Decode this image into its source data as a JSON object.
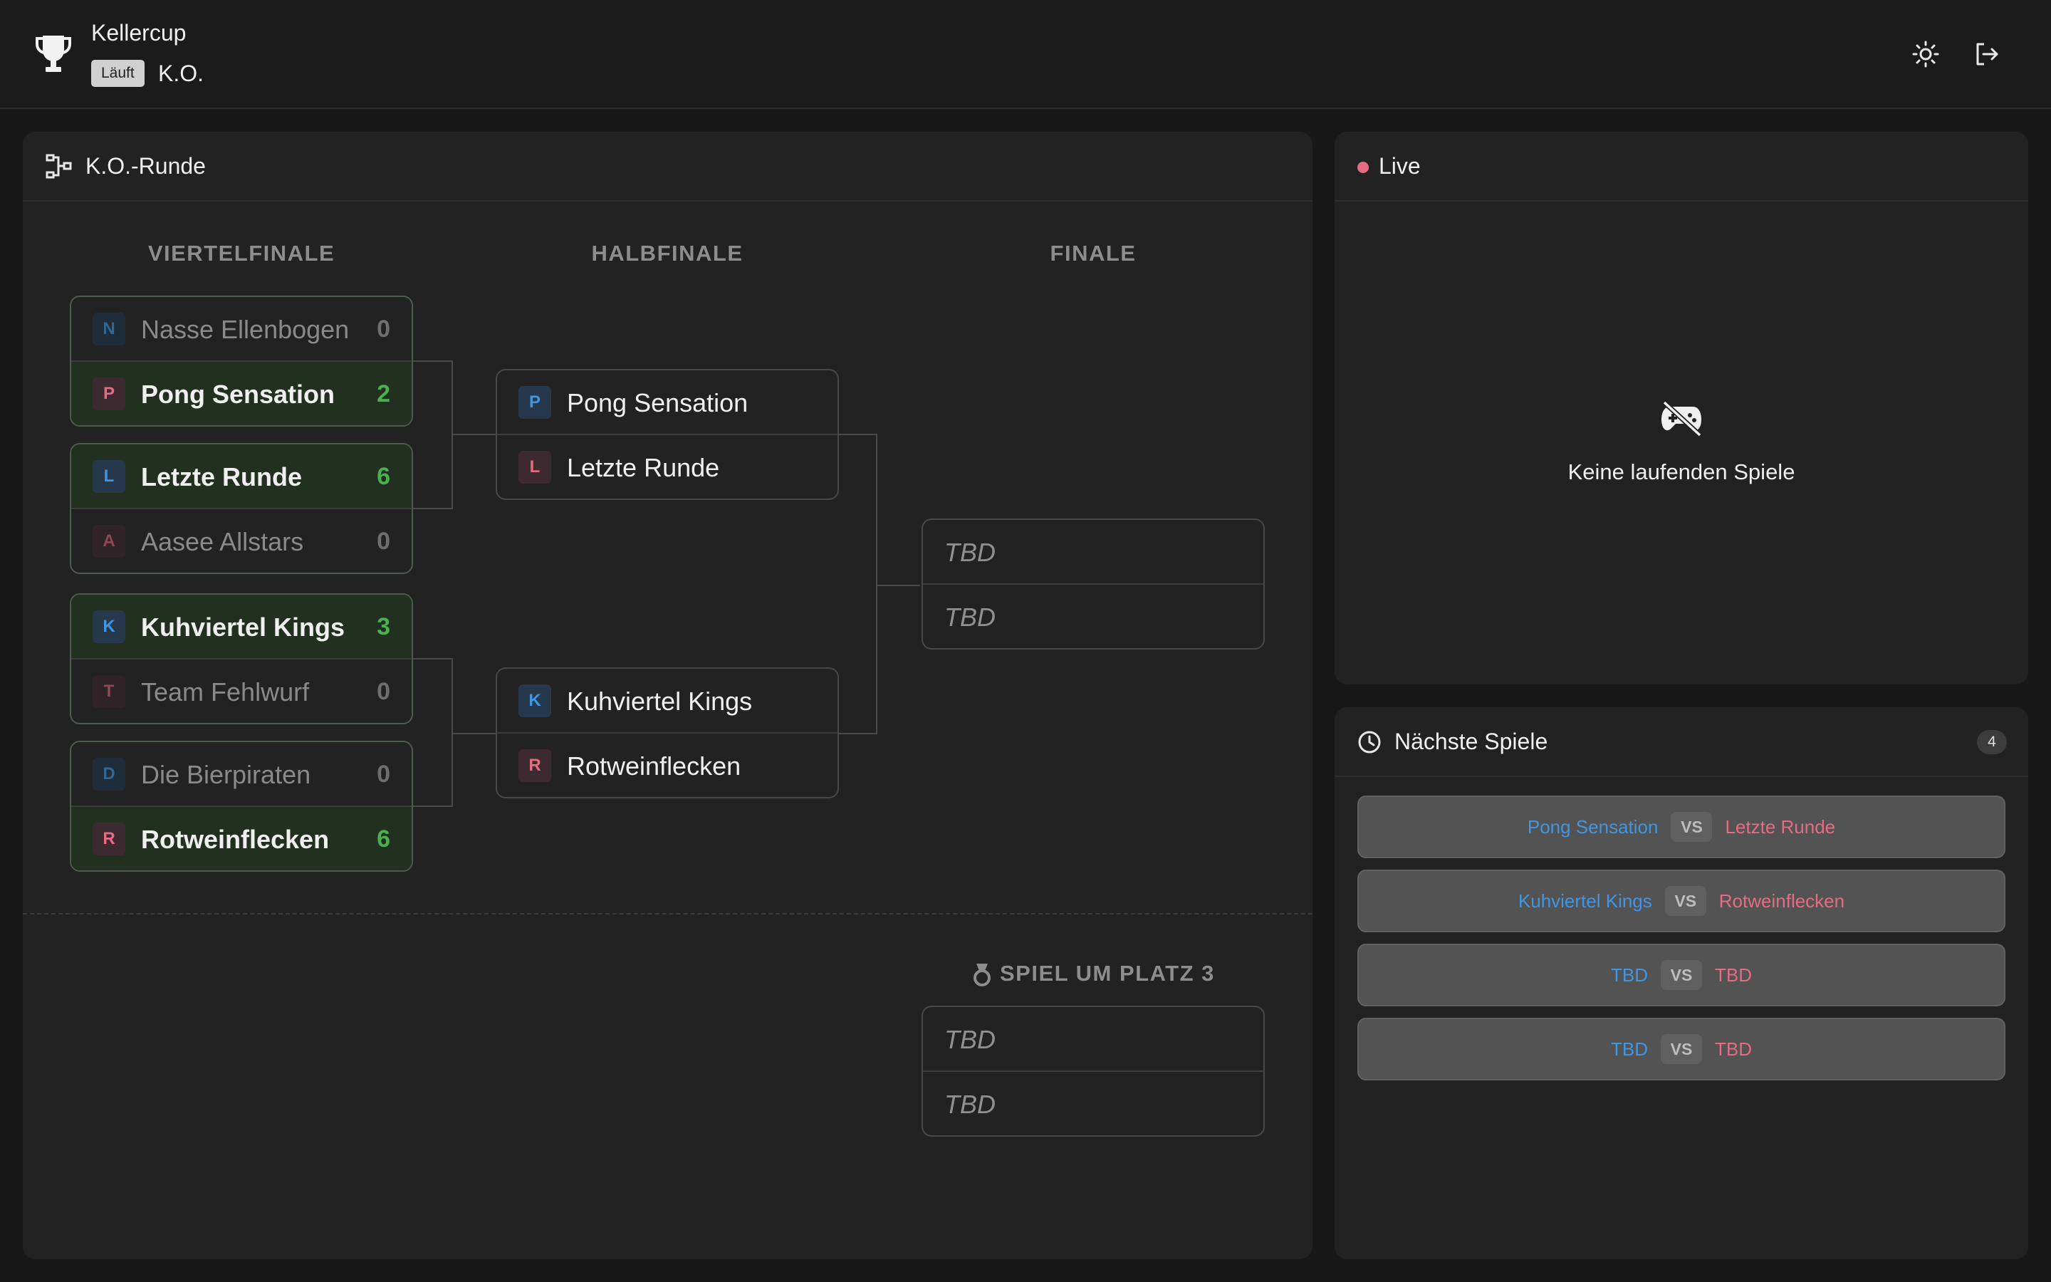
{
  "header": {
    "title": "Kellercup",
    "status": "Läuft",
    "phase": "K.O.",
    "icons": {
      "logo": "trophy-icon",
      "theme": "brightness-icon",
      "logout": "logout-icon"
    }
  },
  "bracket": {
    "title": "K.O.-Runde",
    "rounds": [
      "VIERTELFINALE",
      "HALBFINALE",
      "FINALE"
    ],
    "quarterfinals": [
      {
        "top": {
          "initial": "N",
          "name": "Nasse Ellenbogen",
          "score": "0"
        },
        "bottom": {
          "initial": "P",
          "name": "Pong Sensation",
          "score": "2"
        }
      },
      {
        "top": {
          "initial": "L",
          "name": "Letzte Runde",
          "score": "6"
        },
        "bottom": {
          "initial": "A",
          "name": "Aasee Allstars",
          "score": "0"
        }
      },
      {
        "top": {
          "initial": "K",
          "name": "Kuhviertel Kings",
          "score": "3"
        },
        "bottom": {
          "initial": "T",
          "name": "Team Fehlwurf",
          "score": "0"
        }
      },
      {
        "top": {
          "initial": "D",
          "name": "Die Bierpiraten",
          "score": "0"
        },
        "bottom": {
          "initial": "R",
          "name": "Rotweinflecken",
          "score": "6"
        }
      }
    ],
    "semifinals": [
      {
        "top": {
          "initial": "P",
          "name": "Pong Sensation"
        },
        "bottom": {
          "initial": "L",
          "name": "Letzte Runde"
        }
      },
      {
        "top": {
          "initial": "K",
          "name": "Kuhviertel Kings"
        },
        "bottom": {
          "initial": "R",
          "name": "Rotweinflecken"
        }
      }
    ],
    "final": {
      "top": "TBD",
      "bottom": "TBD"
    },
    "third_place": {
      "title": "SPIEL UM PLATZ 3",
      "top": "TBD",
      "bottom": "TBD"
    }
  },
  "live": {
    "title": "Live",
    "empty_text": "Keine laufenden Spiele"
  },
  "upcoming": {
    "title": "Nächste Spiele",
    "count": "4",
    "vs_label": "VS",
    "matches": [
      {
        "a": "Pong Sensation",
        "b": "Letzte Runde"
      },
      {
        "a": "Kuhviertel Kings",
        "b": "Rotweinflecken"
      },
      {
        "a": "TBD",
        "b": "TBD"
      },
      {
        "a": "TBD",
        "b": "TBD"
      }
    ]
  },
  "colors": {
    "accent_blue": "#3f96e4",
    "accent_red": "#e56c82",
    "win_green": "#4caf50",
    "background": "#181818"
  }
}
